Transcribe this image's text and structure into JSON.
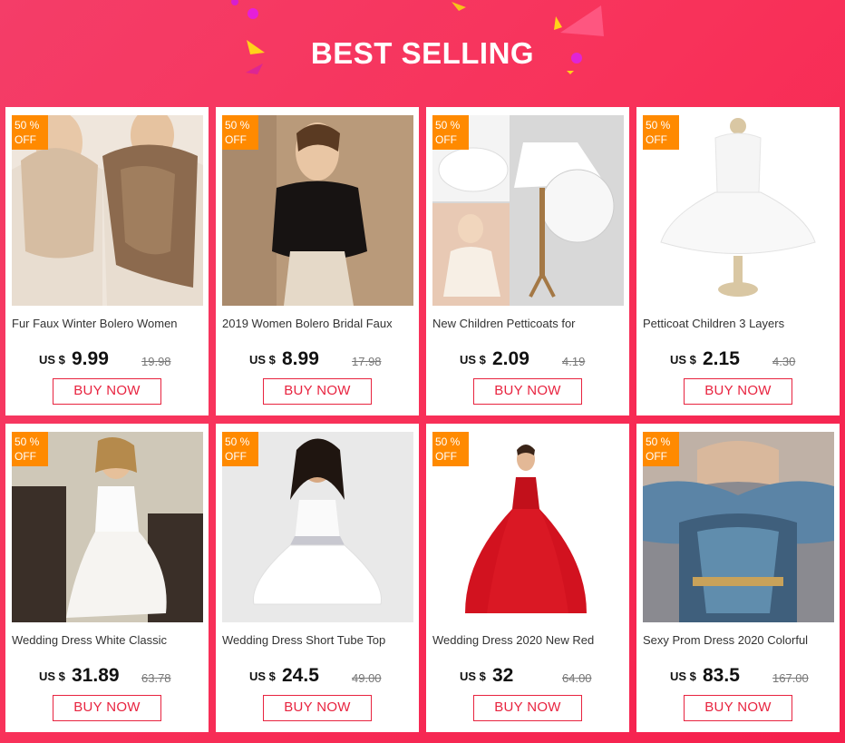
{
  "banner": {
    "title": "BEST SELLING"
  },
  "colors": {
    "accent": "#e8233f",
    "badge": "#ff8a00",
    "background": "#f8325a"
  },
  "products": [
    {
      "badge_percent": "50 %",
      "badge_off": "OFF",
      "name": "Fur Faux Winter Bolero Women",
      "currency": "US $",
      "price": "9.99",
      "original_price": "19.98",
      "buy_label": "BUY NOW",
      "image": "fur-stole-photo"
    },
    {
      "badge_percent": "50 %",
      "badge_off": "OFF",
      "name": "2019 Women Bolero Bridal Faux",
      "currency": "US $",
      "price": "8.99",
      "original_price": "17.98",
      "buy_label": "BUY NOW",
      "image": "black-bolero-photo"
    },
    {
      "badge_percent": "50 %",
      "badge_off": "OFF",
      "name": "New Children Petticoats for",
      "currency": "US $",
      "price": "2.09",
      "original_price": "4.19",
      "buy_label": "BUY NOW",
      "image": "petticoat-photo"
    },
    {
      "badge_percent": "50 %",
      "badge_off": "OFF",
      "name": "Petticoat Children 3 Layers",
      "currency": "US $",
      "price": "2.15",
      "original_price": "4.30",
      "buy_label": "BUY NOW",
      "image": "petticoat-mannequin-photo"
    },
    {
      "badge_percent": "50 %",
      "badge_off": "OFF",
      "name": "Wedding Dress White Classic",
      "currency": "US $",
      "price": "31.89",
      "original_price": "63.78",
      "buy_label": "BUY NOW",
      "image": "white-wedding-dress-photo"
    },
    {
      "badge_percent": "50 %",
      "badge_off": "OFF",
      "name": "Wedding Dress Short Tube Top",
      "currency": "US $",
      "price": "24.5",
      "original_price": "49.00",
      "buy_label": "BUY NOW",
      "image": "short-white-dress-photo"
    },
    {
      "badge_percent": "50 %",
      "badge_off": "OFF",
      "name": "Wedding Dress 2020 New Red",
      "currency": "US $",
      "price": "32",
      "original_price": "64.00",
      "buy_label": "BUY NOW",
      "image": "red-ball-gown-photo"
    },
    {
      "badge_percent": "50 %",
      "badge_off": "OFF",
      "name": "Sexy Prom Dress 2020 Colorful",
      "currency": "US $",
      "price": "83.5",
      "original_price": "167.00",
      "buy_label": "BUY NOW",
      "image": "blue-prom-dress-photo"
    }
  ]
}
